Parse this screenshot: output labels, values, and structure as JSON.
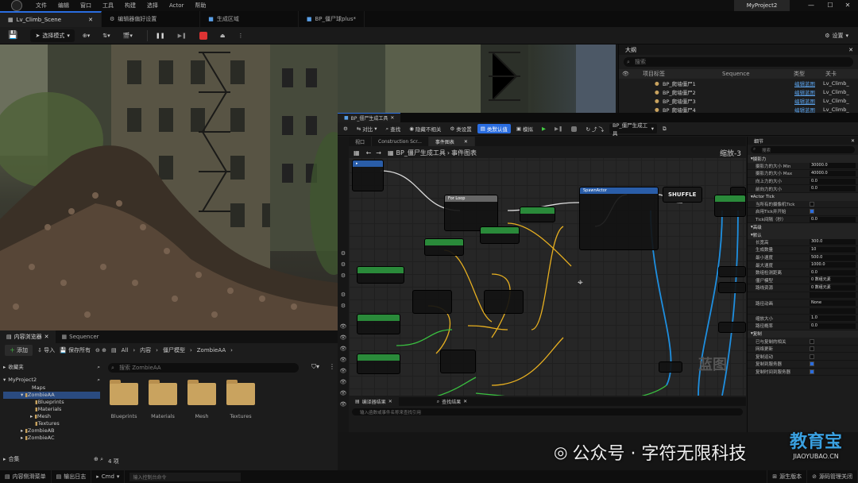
{
  "menu": {
    "items": [
      "文件",
      "编辑",
      "窗口",
      "工具",
      "构建",
      "选择",
      "Actor",
      "帮助"
    ],
    "project": "MyProject2"
  },
  "tabs": [
    {
      "label": "Lv_Climb_Scene",
      "active": true
    },
    {
      "label": "编辑器偏好设置"
    },
    {
      "label": "生成区域"
    },
    {
      "label": "BP_僵尸球plus*"
    }
  ],
  "toolbar": {
    "mode": "选择模式",
    "settings": "设置"
  },
  "outliner": {
    "title": "大纲",
    "search_placeholder": "搜索",
    "col_label": "项目标签",
    "col_sequence": "Sequence",
    "col_type": "类型",
    "col_link": "关卡",
    "rows": [
      {
        "label": "BP_爬墙僵尸1",
        "type": "编辑蓝图",
        "level": "Lv_Climb_"
      },
      {
        "label": "BP_爬墙僵尸2",
        "type": "编辑蓝图",
        "level": "Lv_Climb_"
      },
      {
        "label": "BP_爬墙僵尸3",
        "type": "编辑蓝图",
        "level": "Lv_Climb_"
      },
      {
        "label": "BP_爬墙僵尸4",
        "type": "编辑蓝图",
        "level": "Lv_Climb_"
      }
    ]
  },
  "blueprint": {
    "title": "BP_僵尸生成工具",
    "toolbar": [
      "对比",
      "查找",
      "隐藏不相关",
      "类设置",
      "类默认值",
      "模拟"
    ],
    "debug_target": "BP_僵尸生成工具",
    "subtabs": [
      "视口",
      "Construction Scr...",
      "事件图表"
    ],
    "breadcrumb": [
      "BP_僵尸生成工具",
      "事件图表"
    ],
    "zoom": "缩放-3",
    "shuffle": "SHUFFLE",
    "compile_tab": "编译器结果",
    "find_tab": "查找结果",
    "find_placeholder": "输入函数或事件名称来查找引用",
    "watermark": "蓝图"
  },
  "details": {
    "title": "细节",
    "search_placeholder": "搜索",
    "rows": [
      {
        "type": "sec",
        "label": "摄影力"
      },
      {
        "label": "摄影力的大小 Min",
        "value": "30000.0"
      },
      {
        "label": "摄影力的大小 Max",
        "value": "40000.0"
      },
      {
        "label": "向上力的大小",
        "value": "0.0"
      },
      {
        "label": "前向力的大小",
        "value": "0.0"
      },
      {
        "type": "sec",
        "label": "Actor Tick"
      },
      {
        "label": "当所有的摄像机Tick",
        "check": false
      },
      {
        "label": "启用Tick并开始",
        "check": true
      },
      {
        "label": "Tick间隔（秒）",
        "value": "0.0"
      },
      {
        "type": "sec",
        "label": "高级"
      },
      {
        "type": "sec",
        "label": "默认"
      },
      {
        "label": "长宽高",
        "value": "300.0"
      },
      {
        "label": "生成数量",
        "value": "10"
      },
      {
        "label": "最小速度",
        "value": "500.0"
      },
      {
        "label": "最大速度",
        "value": "1000.0"
      },
      {
        "label": "数组检测距离",
        "value": "0.0"
      },
      {
        "label": "僵尸模型",
        "value": "0 数组元素"
      },
      {
        "label": "路线资源",
        "value": "0 数组元素"
      },
      {
        "label": "",
        "value": ""
      },
      {
        "label": "路径动画",
        "value": "None"
      },
      {
        "label": "",
        "value": ""
      },
      {
        "label": "缩放大小",
        "value": "1.0"
      },
      {
        "label": "路径概率",
        "value": "0.0"
      },
      {
        "type": "sec",
        "label": "复制"
      },
      {
        "label": "已与复制的相关",
        "check": false
      },
      {
        "label": "网络更新",
        "check": false
      },
      {
        "label": "复制运动",
        "check": false
      },
      {
        "label": "复制到服务器",
        "check": true
      },
      {
        "label": "复制时间到服务器",
        "check": true
      }
    ]
  },
  "content_browser": {
    "tab1": "内容浏览器",
    "tab2": "Sequencer",
    "add": "添加",
    "import": "导入",
    "save_all": "保存所有",
    "path": [
      "All",
      "内容",
      "僵尸模型",
      "ZombieAA"
    ],
    "favorites": "收藏夹",
    "project": "MyProject2",
    "tree": [
      "Maps",
      "ZombieAA",
      "Blueprints",
      "Materials",
      "Mesh",
      "Textures",
      "ZombieAB",
      "ZombieAC"
    ],
    "search_placeholder": "搜索 ZombieAA",
    "folders": [
      "Blueprints",
      "Materials",
      "Mesh",
      "Textures"
    ],
    "count": "4 项",
    "collections": "合集"
  },
  "bottom": {
    "drawer": "内容侧滑菜单",
    "log": "输出日志",
    "cmd": "Cmd",
    "cmd_placeholder": "输入控制台命令",
    "source": "源生版本",
    "source_control": "源码管理关闭"
  },
  "watermark": {
    "text": "公众号 · 字符无限科技",
    "logo": "教育宝",
    "url": "JIAOYUBAO.CN"
  }
}
